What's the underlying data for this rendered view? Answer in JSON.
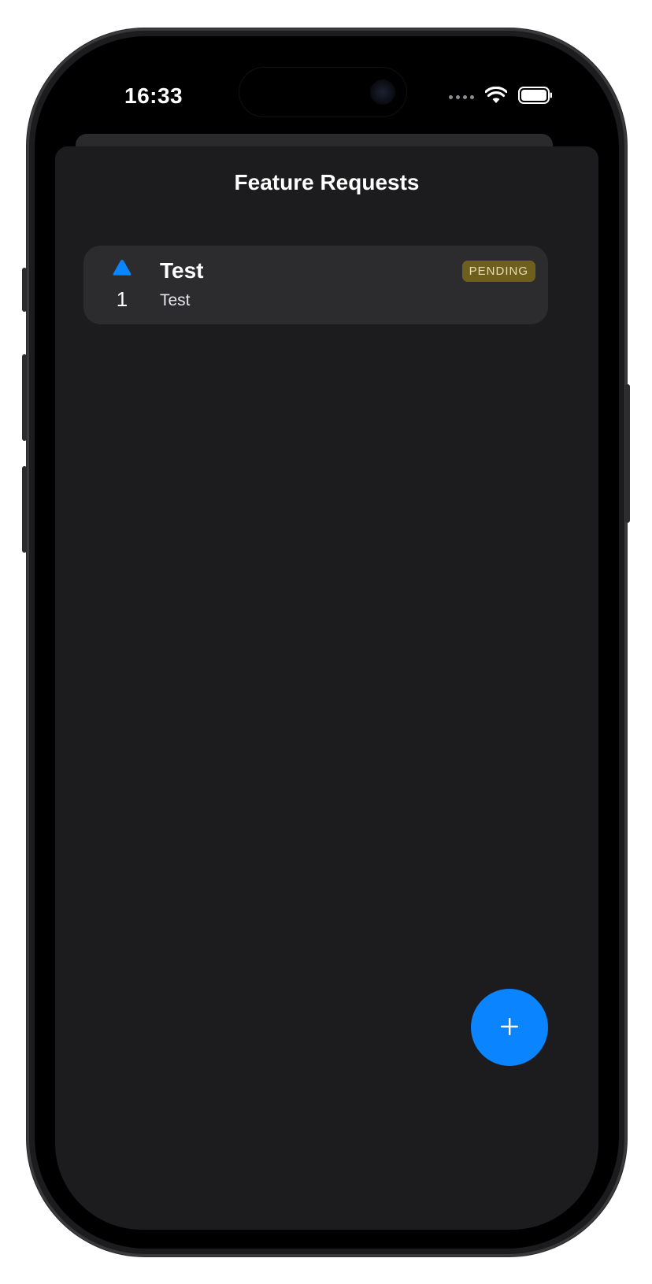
{
  "status_bar": {
    "time": "16:33",
    "signal_icon": "signal-dots-icon",
    "wifi_icon": "wifi-icon",
    "battery_icon": "battery-icon"
  },
  "screen": {
    "title": "Feature Requests"
  },
  "requests": [
    {
      "title": "Test",
      "description": "Test",
      "votes": "1",
      "status": "PENDING",
      "vote_icon": "upvote-triangle-icon"
    }
  ],
  "fab": {
    "icon": "plus-icon"
  },
  "colors": {
    "accent": "#0a84ff",
    "background": "#1c1c1e",
    "card": "#2c2c2e",
    "pending_badge": "#6e5f1f"
  }
}
